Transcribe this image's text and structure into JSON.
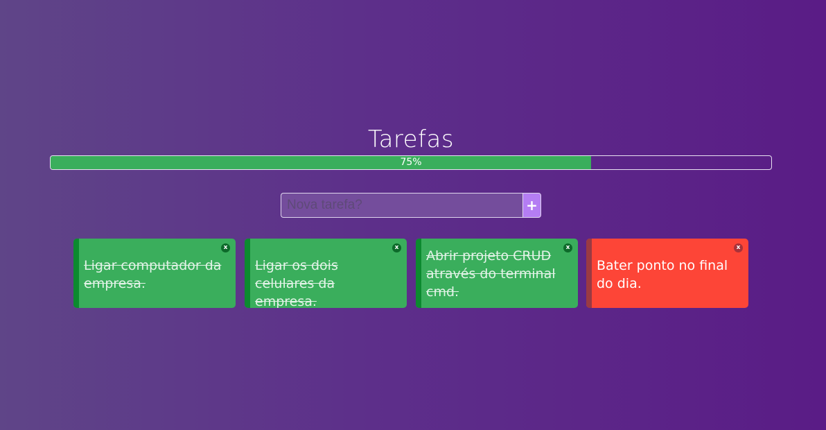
{
  "header": {
    "title": "Tarefas"
  },
  "progress": {
    "percent": 75,
    "label": "75%",
    "fill_color": "#3aae5c"
  },
  "new_task": {
    "placeholder": "Nova tarefa?",
    "value": "",
    "add_label": "+"
  },
  "tasks": [
    {
      "text": "Ligar computador da empresa.",
      "done": true,
      "delete_label": "x"
    },
    {
      "text": "Ligar os dois celulares da empresa.",
      "done": true,
      "delete_label": "x"
    },
    {
      "text": "Abrir projeto CRUD através do terminal cmd.",
      "done": true,
      "delete_label": "x"
    },
    {
      "text": "Bater ponto no final do dia.",
      "done": false,
      "delete_label": "x"
    }
  ],
  "colors": {
    "done": "#3aae5c",
    "done_accent": "#0c8a2f",
    "pending": "#fd4537",
    "pending_accent": "#9a3a43",
    "add_button": "#b47df3"
  }
}
